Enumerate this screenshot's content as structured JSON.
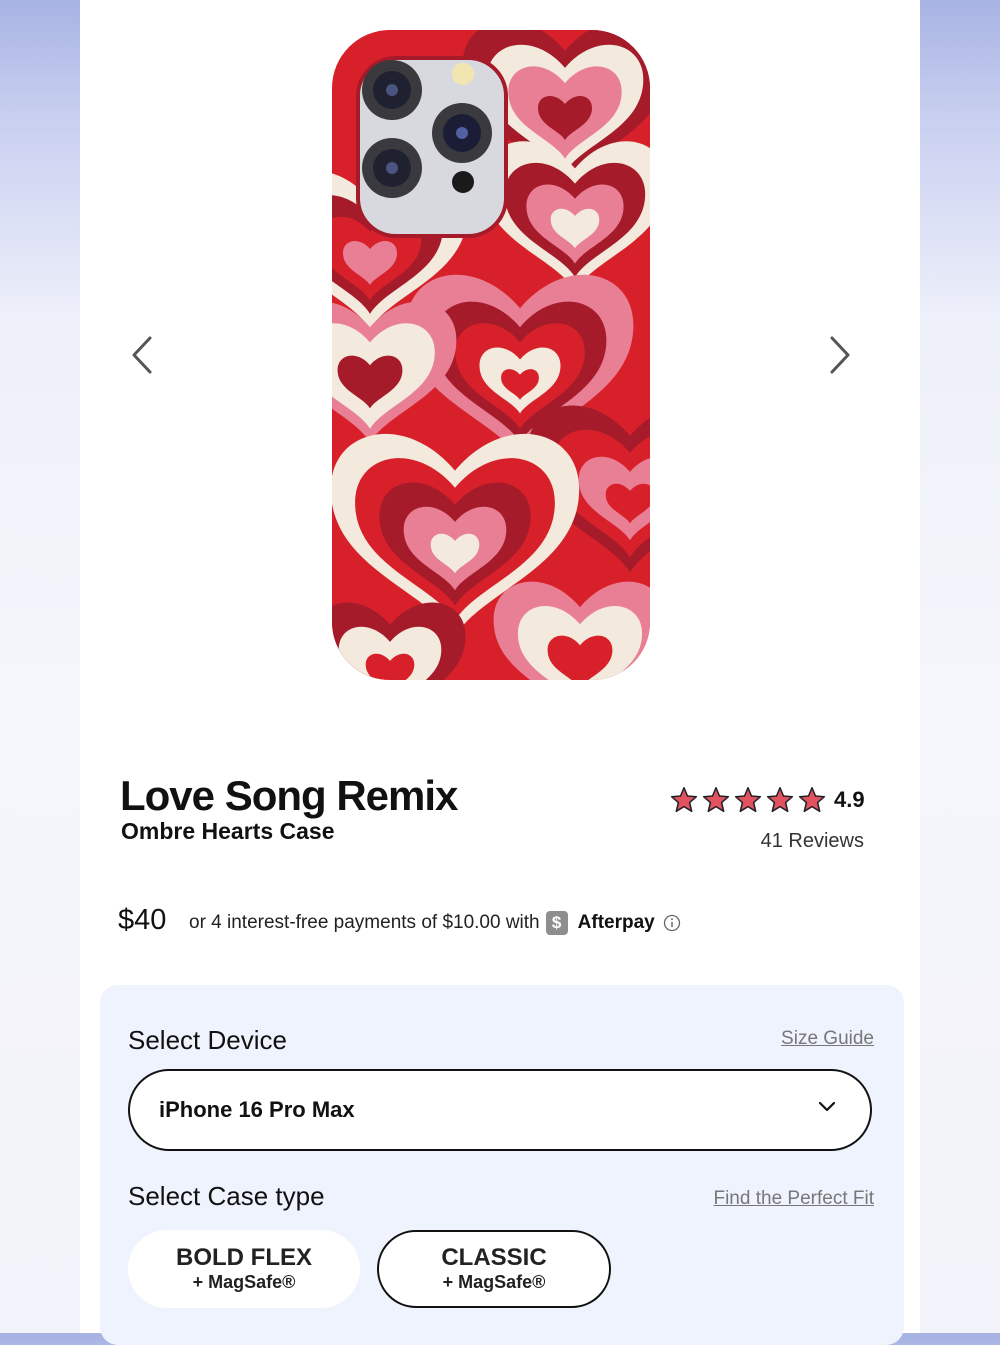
{
  "product": {
    "title": "Love Song Remix",
    "subtitle": "Ombre Hearts Case",
    "rating": "4.9",
    "stars": 5,
    "reviews": "41 Reviews",
    "price": "$40",
    "installment_text": "or 4 interest-free payments of $10.00 with",
    "afterpay_logo": "$",
    "afterpay_name": "Afterpay"
  },
  "icons": {
    "prev": "chevron-left-icon",
    "next": "chevron-right-icon",
    "star": "star-icon",
    "info": "info-icon",
    "dropdown": "chevron-down-icon"
  },
  "colors": {
    "case_red": "#d8202a",
    "case_dark_red": "#a51b2a",
    "case_pink": "#e87f94",
    "case_cream": "#f3e9dc",
    "star": "#e0525f",
    "panel_bg": "#eef3fd"
  },
  "options": {
    "device_label": "Select Device",
    "size_guide": "Size Guide",
    "device_value": "iPhone 16 Pro Max",
    "case_label": "Select Case type",
    "fit_link": "Find the Perfect Fit",
    "case_types": [
      {
        "name": "BOLD FLEX",
        "sub": "+ MagSafe®",
        "selected": false
      },
      {
        "name": "CLASSIC",
        "sub": "+ MagSafe®",
        "selected": true
      }
    ]
  }
}
